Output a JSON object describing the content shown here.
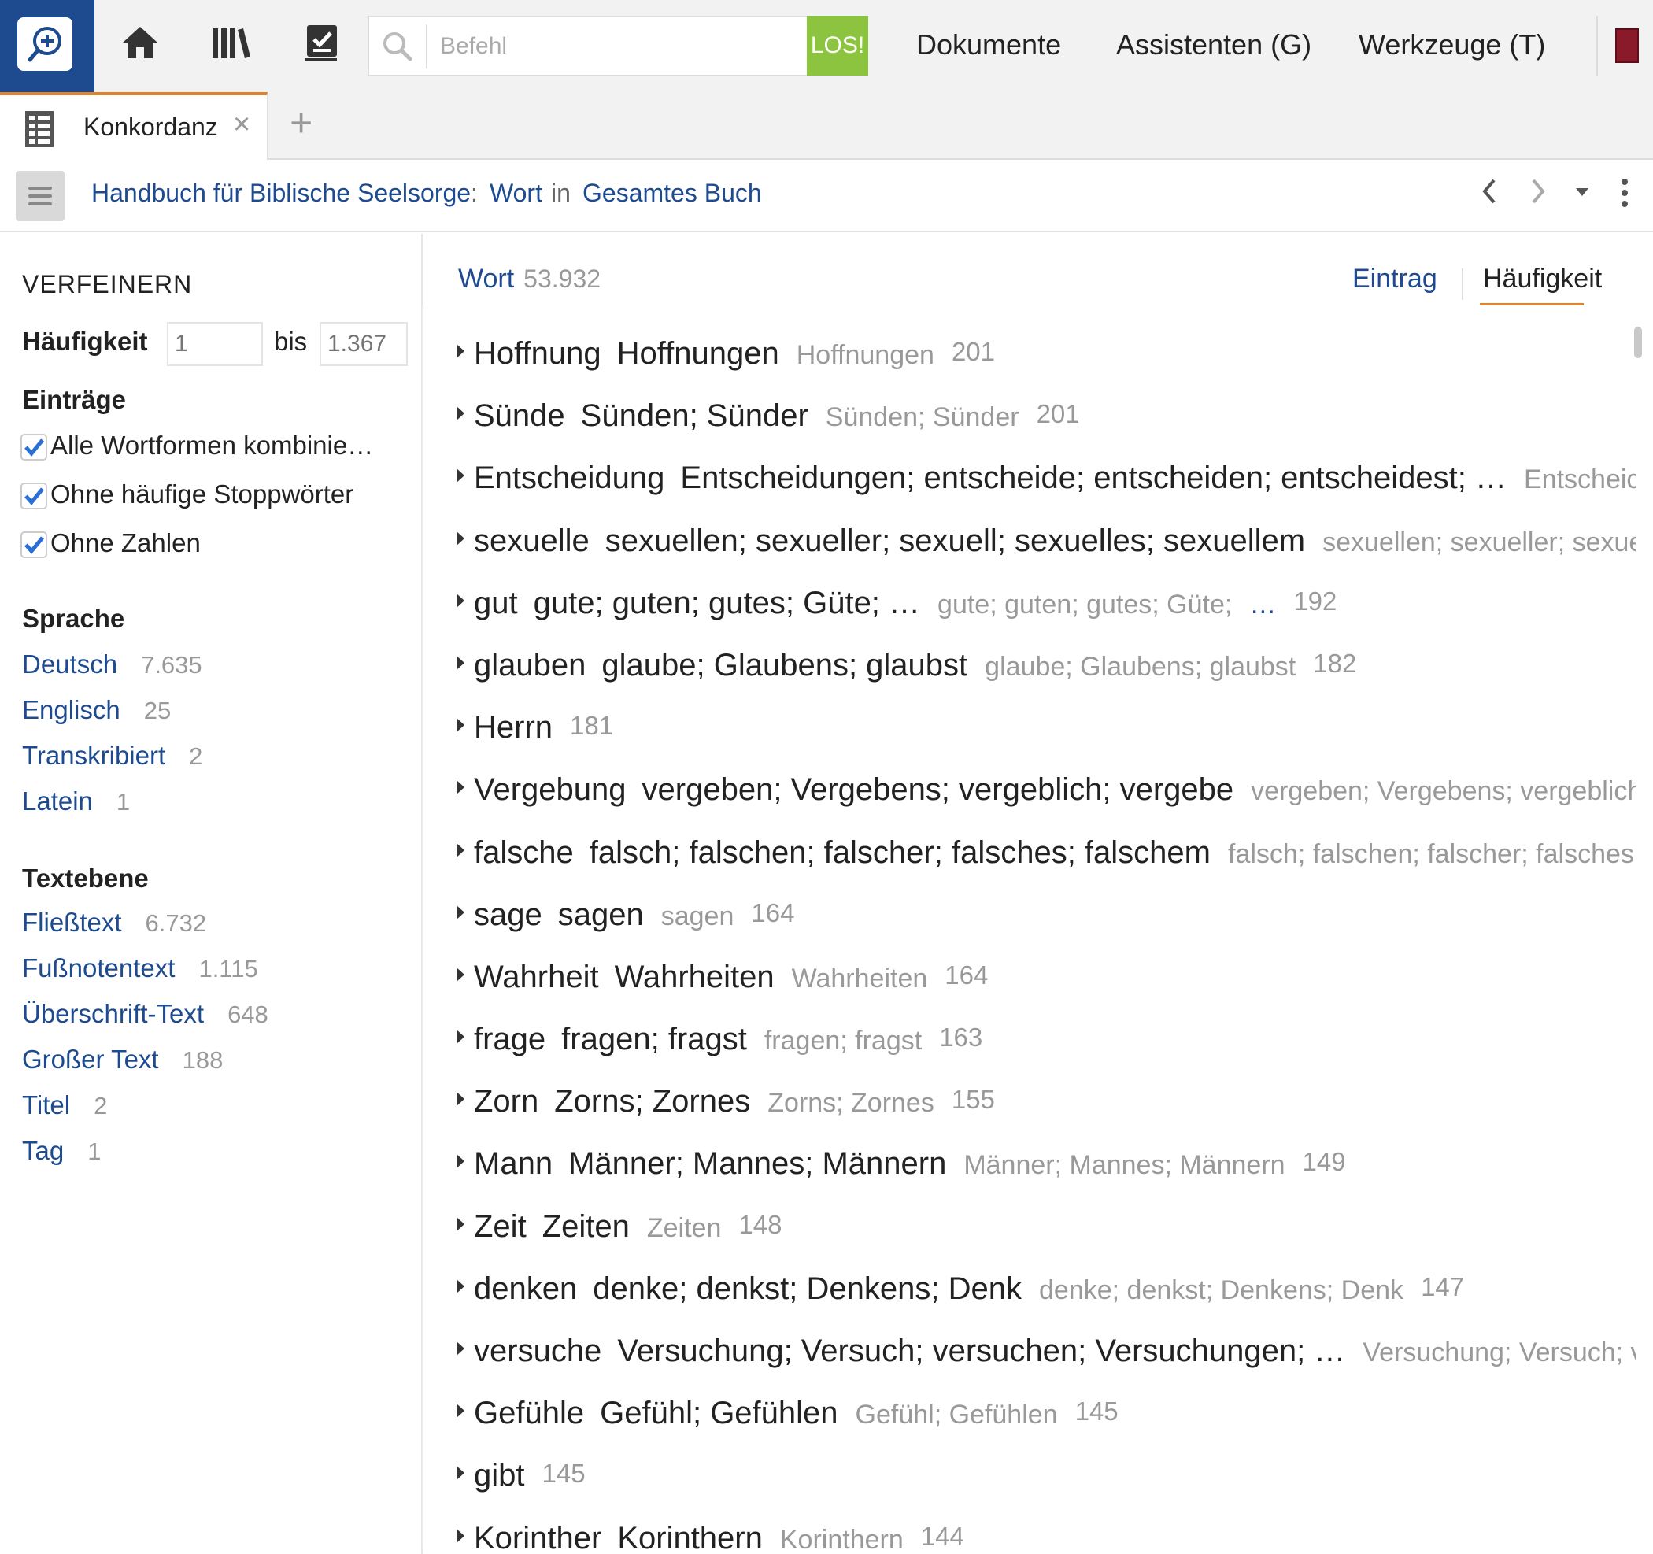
{
  "toolbar": {
    "search_placeholder": "Befehl",
    "go_label": "LOS!",
    "menus": [
      "Dokumente",
      "Assistenten (G)",
      "Werkzeuge (T)"
    ]
  },
  "tabs": {
    "active_label": "Konkordanz",
    "close_glyph": "×",
    "add_glyph": "+"
  },
  "breadcrumb": {
    "resource": "Handbuch für Biblische Seelsorge",
    "separator": ":",
    "type": "Wort",
    "in_word": "in",
    "scope": "Gesamtes Buch"
  },
  "sidebar": {
    "heading": "VERFEINERN",
    "frequency": {
      "label": "Häufigkeit",
      "from": "1",
      "to_word": "bis",
      "to": "1.367"
    },
    "entries": {
      "title": "Einträge",
      "options": [
        {
          "label": "Alle Wortformen kombinie…",
          "checked": true
        },
        {
          "label": "Ohne häufige Stoppwörter",
          "checked": true
        },
        {
          "label": "Ohne Zahlen",
          "checked": true
        }
      ]
    },
    "language": {
      "title": "Sprache",
      "items": [
        {
          "name": "Deutsch",
          "count": "7.635"
        },
        {
          "name": "Englisch",
          "count": "25"
        },
        {
          "name": "Transkribiert",
          "count": "2"
        },
        {
          "name": "Latein",
          "count": "1"
        }
      ]
    },
    "text_level": {
      "title": "Textebene",
      "items": [
        {
          "name": "Fließtext",
          "count": "6.732"
        },
        {
          "name": "Fußnotentext",
          "count": "1.115"
        },
        {
          "name": "Überschrift-Text",
          "count": "648"
        },
        {
          "name": "Großer Text",
          "count": "188"
        },
        {
          "name": "Titel",
          "count": "2"
        },
        {
          "name": "Tag",
          "count": "1"
        }
      ]
    }
  },
  "main": {
    "header_label": "Wort",
    "header_count": "53.932",
    "view_entry": "Eintrag",
    "view_frequency": "Häufigkeit",
    "rows": [
      {
        "lemma": "Hoffnung",
        "forms": "Hoffnungen",
        "gray": "Hoffnungen",
        "count": "201"
      },
      {
        "lemma": "Sünde",
        "forms": "Sünden; Sünder",
        "gray": "Sünden; Sünder",
        "count": "201"
      },
      {
        "lemma": "Entscheidung",
        "forms": "Entscheidungen; entscheide; entscheiden; entscheidest; …",
        "gray": "Entscheic",
        "count": ""
      },
      {
        "lemma": "sexuelle",
        "forms": "sexuellen; sexueller; sexuell; sexuelles; sexuellem",
        "gray": "sexuellen; sexueller; sexuel",
        "count": ""
      },
      {
        "lemma": "gut",
        "forms": "gute; guten; gutes; Güte; …",
        "gray": "gute; guten; gutes; Güte;",
        "more": "…",
        "count": "192"
      },
      {
        "lemma": "glauben",
        "forms": "glaube; Glaubens; glaubst",
        "gray": "glaube; Glaubens; glaubst",
        "count": "182"
      },
      {
        "lemma": "Herrn",
        "forms": "",
        "gray": "",
        "count": "181"
      },
      {
        "lemma": "Vergebung",
        "forms": "vergeben; Vergebens; vergeblich; vergebe",
        "gray": "vergeben; Vergebens; vergeblich;",
        "count": ""
      },
      {
        "lemma": "falsche",
        "forms": "falsch; falschen; falscher; falsches; falschem",
        "gray": "falsch; falschen; falscher; falsches;",
        "count": ""
      },
      {
        "lemma": "sage",
        "forms": "sagen",
        "gray": "sagen",
        "count": "164"
      },
      {
        "lemma": "Wahrheit",
        "forms": "Wahrheiten",
        "gray": "Wahrheiten",
        "count": "164"
      },
      {
        "lemma": "frage",
        "forms": "fragen; fragst",
        "gray": "fragen; fragst",
        "count": "163"
      },
      {
        "lemma": "Zorn",
        "forms": "Zorns; Zornes",
        "gray": "Zorns; Zornes",
        "count": "155"
      },
      {
        "lemma": "Mann",
        "forms": "Männer; Mannes; Männern",
        "gray": "Männer; Mannes; Männern",
        "count": "149"
      },
      {
        "lemma": "Zeit",
        "forms": "Zeiten",
        "gray": "Zeiten",
        "count": "148"
      },
      {
        "lemma": "denken",
        "forms": "denke; denkst; Denkens; Denk",
        "gray": "denke; denkst; Denkens; Denk",
        "count": "147"
      },
      {
        "lemma": "versuche",
        "forms": "Versuchung; Versuch; versuchen; Versuchungen; …",
        "gray": "Versuchung; Versuch; ve",
        "count": ""
      },
      {
        "lemma": "Gefühle",
        "forms": "Gefühl; Gefühlen",
        "gray": "Gefühl; Gefühlen",
        "count": "145"
      },
      {
        "lemma": "gibt",
        "forms": "",
        "gray": "",
        "count": "145"
      },
      {
        "lemma": "Korinther",
        "forms": "Korinthern",
        "gray": "Korinthern",
        "count": "144"
      }
    ]
  },
  "colors": {
    "link_blue": "#1e4b8f",
    "accent_orange": "#e2822b",
    "go_green": "#8cc43f",
    "muted_gray": "#999999"
  },
  "icons": [
    "search-document-icon",
    "home-icon",
    "library-icon",
    "checklist-icon",
    "search-icon",
    "concordance-icon",
    "panel-menu-icon",
    "chevron-left-icon",
    "chevron-right-icon",
    "dropdown-icon",
    "more-vertical-icon",
    "expand-triangle-icon",
    "checkbox-checked-icon"
  ]
}
